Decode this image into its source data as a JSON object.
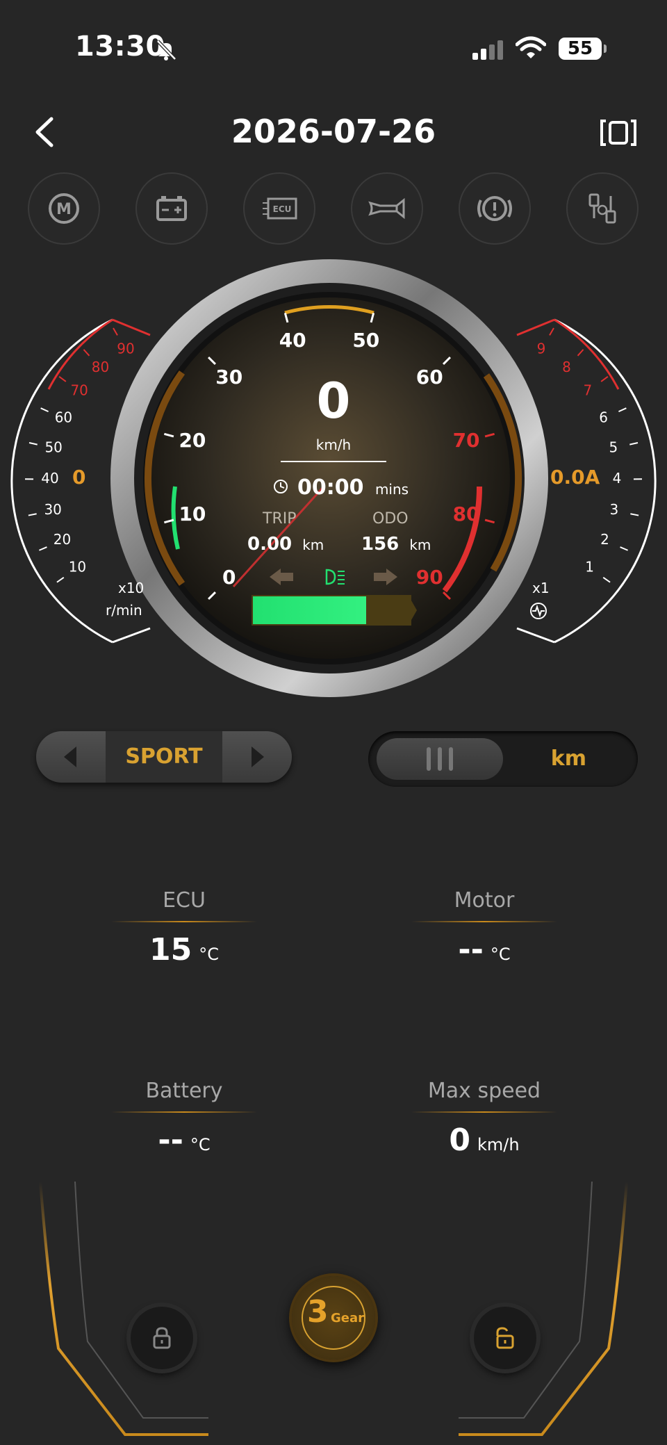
{
  "status_bar": {
    "time": "13:30",
    "battery": "55"
  },
  "header": {
    "date": "2026-07-26"
  },
  "icons": [
    "motor-icon",
    "battery-icon",
    "ecu-icon",
    "horn-icon",
    "brake-warning-icon",
    "connector-icon"
  ],
  "icon_ecu_label": "ECU",
  "icon_motor_label": "M",
  "speedometer": {
    "speed": "0",
    "speed_unit": "km/h",
    "time": "00:00",
    "time_unit": "mins",
    "trip_label": "TRIP",
    "trip_value": "0.00",
    "trip_unit": "km",
    "odo_label": "ODO",
    "odo_value": "156",
    "odo_unit": "km",
    "ticks": [
      "0",
      "10",
      "20",
      "30",
      "40",
      "50",
      "60",
      "70",
      "80",
      "90"
    ],
    "battery_level": 0.72
  },
  "rpm_gauge": {
    "value": "0",
    "multiplier": "x10",
    "unit": "r/min",
    "ticks": [
      "10",
      "20",
      "30",
      "40",
      "50",
      "60",
      "70",
      "80",
      "90"
    ]
  },
  "current_gauge": {
    "value": "0.0A",
    "multiplier": "x1",
    "ticks": [
      "1",
      "2",
      "3",
      "4",
      "5",
      "6",
      "7",
      "8",
      "9"
    ]
  },
  "mode_selector": {
    "mode": "SPORT"
  },
  "unit_toggle": {
    "unit": "km"
  },
  "stats": {
    "ecu": {
      "label": "ECU",
      "value": "15",
      "unit": "°C"
    },
    "motor": {
      "label": "Motor",
      "value": "--",
      "unit": "°C"
    },
    "battery": {
      "label": "Battery",
      "value": "--",
      "unit": "°C"
    },
    "max_speed": {
      "label": "Max speed",
      "value": "0",
      "unit": "km/h"
    }
  },
  "gear": {
    "number": "3",
    "label": "Gear"
  },
  "colors": {
    "accent": "#d9a231",
    "red": "#e03030",
    "green": "#22e070"
  }
}
